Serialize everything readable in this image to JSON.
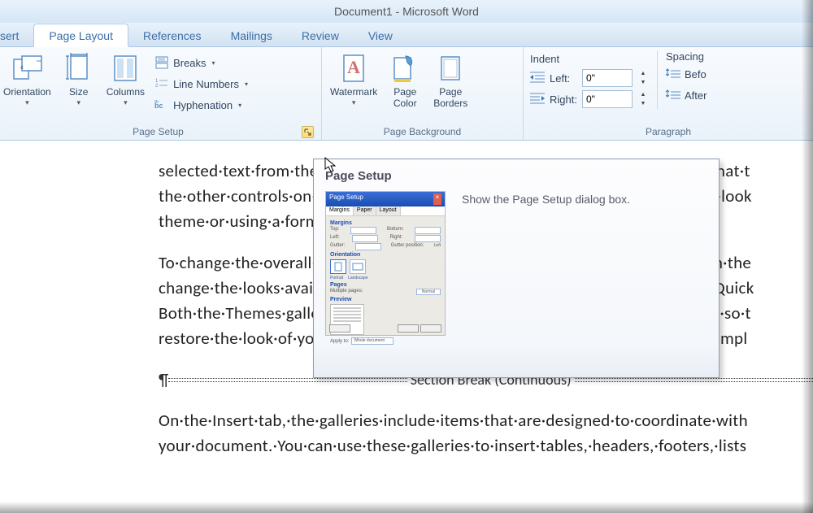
{
  "title": "Document1  -  Microsoft Word",
  "tabs": {
    "insert": "sert",
    "page_layout": "Page Layout",
    "references": "References",
    "mailings": "Mailings",
    "review": "Review",
    "view": "View"
  },
  "page_setup": {
    "label": "Page Setup",
    "orientation": "Orientation",
    "size": "Size",
    "columns": "Columns",
    "breaks": "Breaks",
    "line_numbers": "Line Numbers",
    "hyphenation": "Hyphenation"
  },
  "page_background": {
    "label": "Page Background",
    "watermark": "Watermark",
    "page_color": "Page\nColor",
    "page_borders": "Page\nBorders"
  },
  "paragraph": {
    "label": "Paragraph",
    "indent_header": "Indent",
    "left_label": "Left:",
    "left_value": "0\"",
    "right_label": "Right:",
    "right_value": "0\"",
    "spacing_header": "Spacing",
    "before": "Befo",
    "after": "After"
  },
  "tooltip": {
    "title": "Page Setup",
    "text": "Show the Page Setup dialog box.",
    "thumb": {
      "title": "Page Setup",
      "tabs": [
        "Margins",
        "Paper",
        "Layout"
      ],
      "margins": "Margins",
      "orientation": "Orientation",
      "portrait": "Portrait",
      "landscape": "Landscape",
      "pages": "Pages",
      "multiple": "Multiple pages:",
      "normal": "Normal",
      "preview": "Preview",
      "apply": "Apply to:",
      "apply_val": "Whole document",
      "default": "Default..."
    }
  },
  "document": {
    "line1": "selected·text·from·the·Quick·Styles·gallery·on·the·Home·tab.·You·can·also·format·t",
    "line2": "the·other·controls·on·the·Home·tab.·Most·controls·offer·a·choice·of·using·the·look",
    "line3": "theme·or·using·a·format·that·you·specify·directly.¶",
    "line4": "To·change·the·overall·look·of·your·document,·choose·new·Theme·elements·on·the",
    "line5": "change·the·looks·available·in·the·Quick·Style·gallery,·use·the·Change·Current·Quick",
    "line6": "Both·the·Themes·gallery·and·the·Quick·Styles·gallery·provide·reset·commands·so·t",
    "line7": "restore·the·look·of·your·document·to·the·original·contained·in·your·current·templ",
    "section_break": "Section Break (Continuous)",
    "line8": "On·the·Insert·tab,·the·galleries·include·items·that·are·designed·to·coordinate·with",
    "line9": "your·document.·You·can·use·these·galleries·to·insert·tables,·headers,·footers,·lists"
  }
}
